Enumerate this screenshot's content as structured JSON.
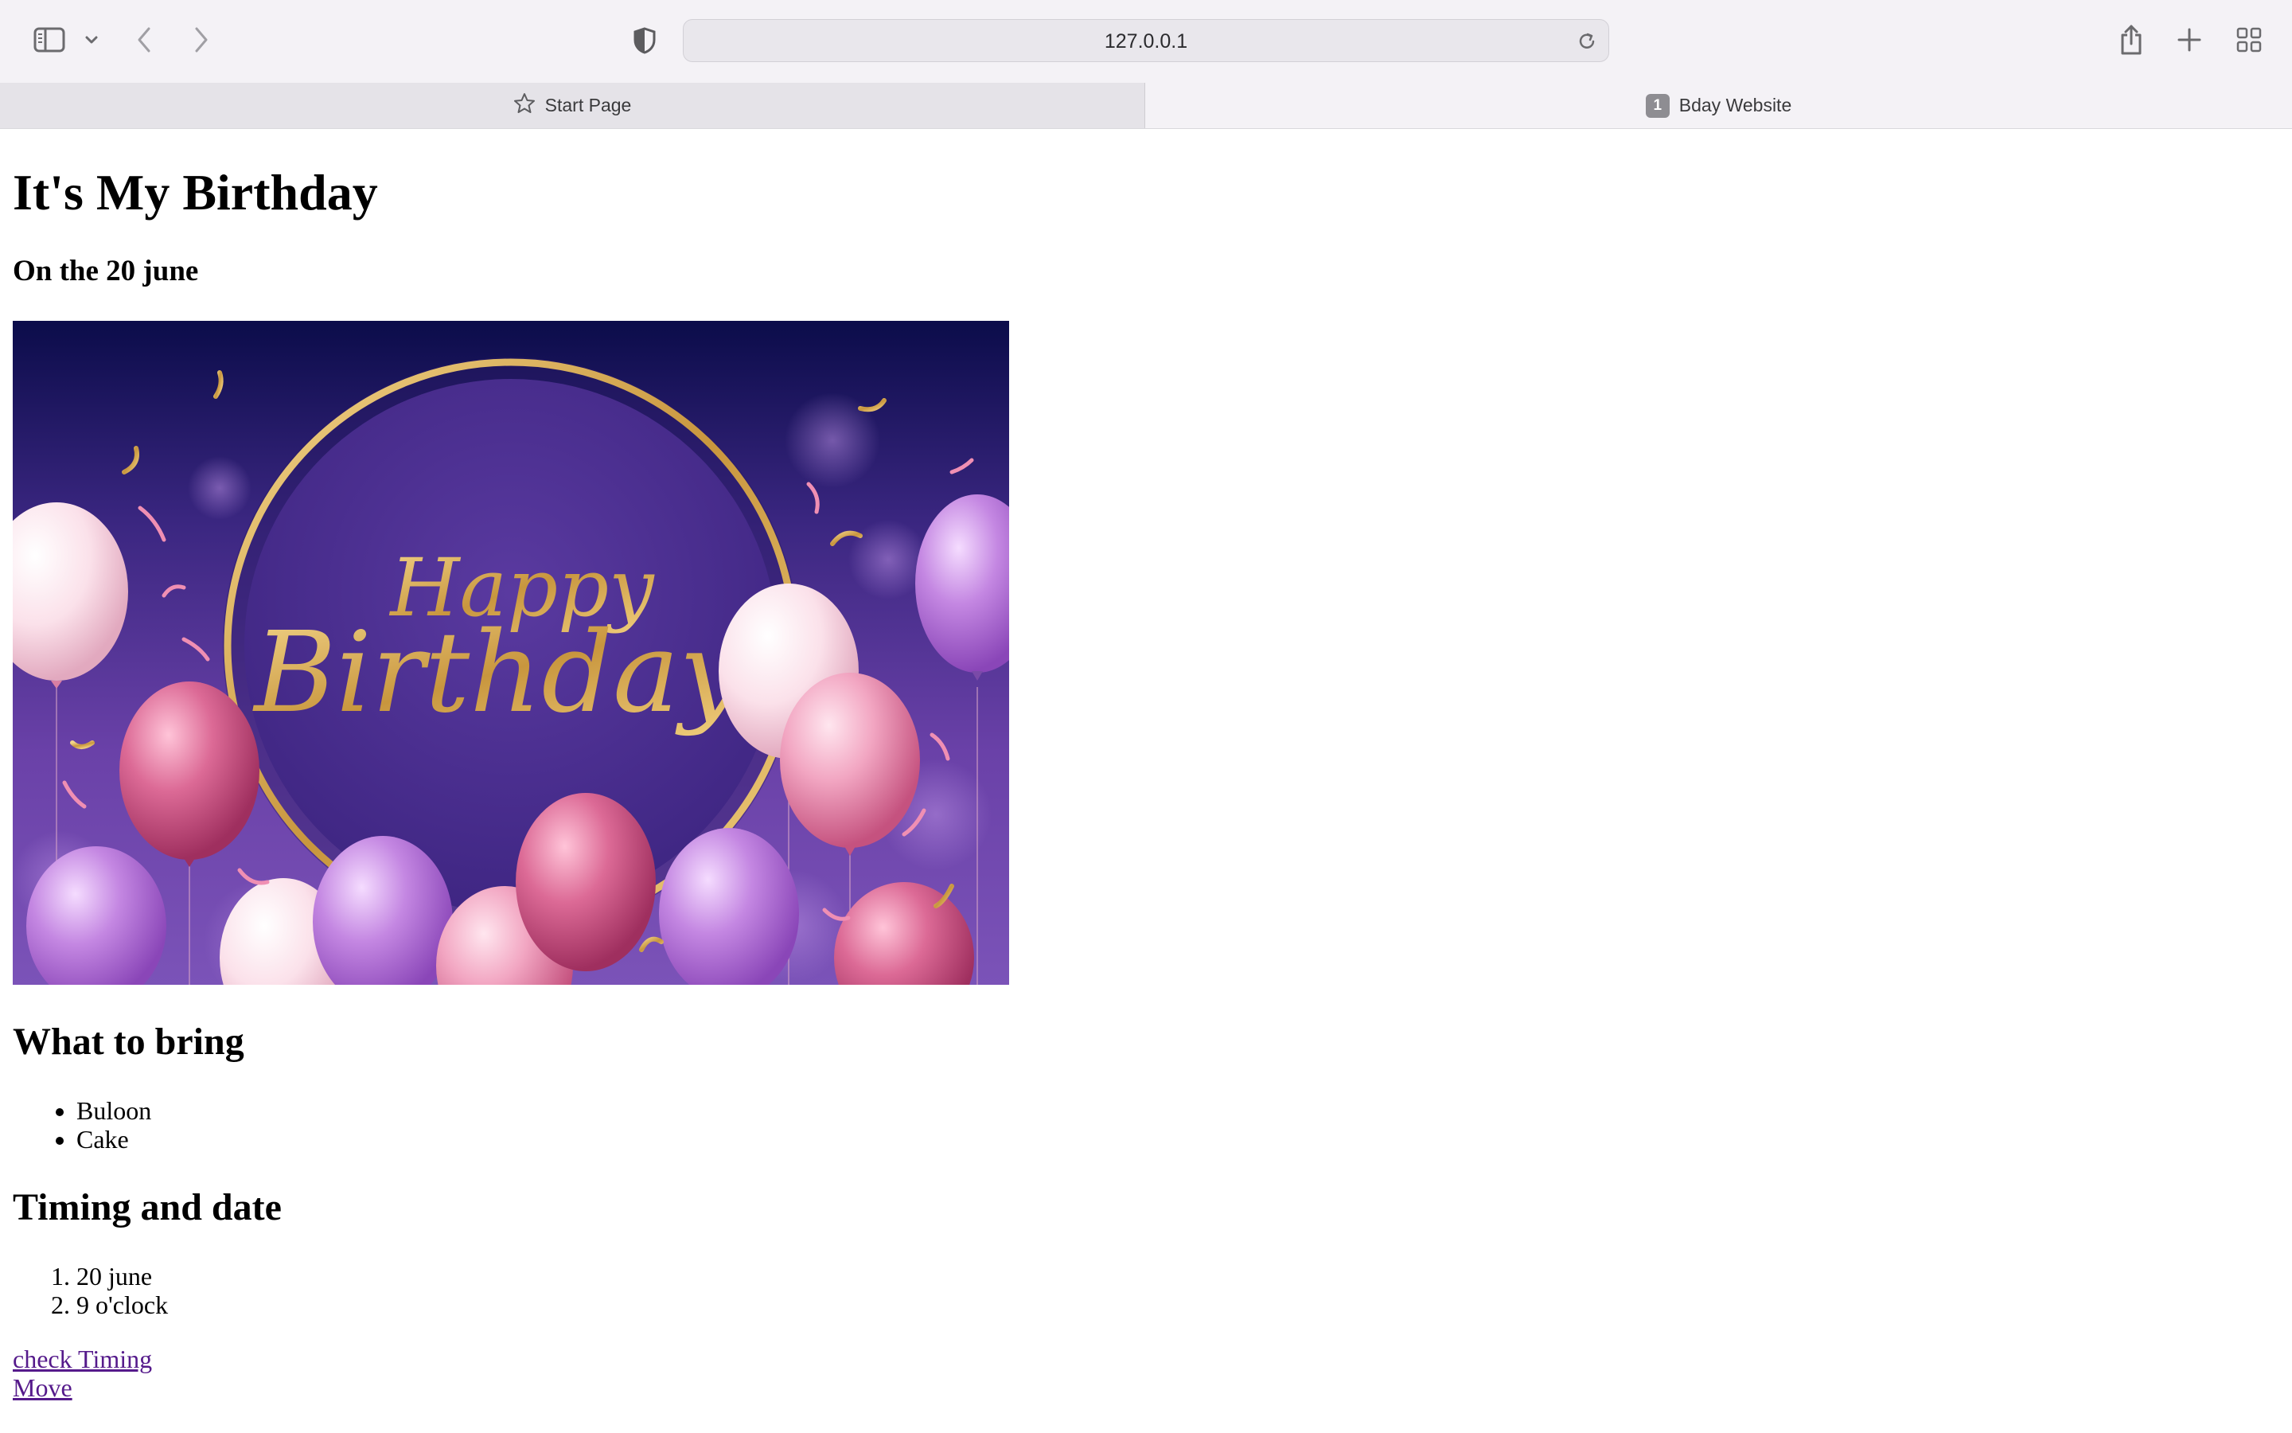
{
  "browser": {
    "url": "127.0.0.1",
    "tabs": [
      {
        "label": "Start Page",
        "active": false
      },
      {
        "label": "Bday Website",
        "active": true,
        "badge": "1"
      }
    ]
  },
  "page": {
    "title": "It's My Birthday",
    "subtitle": "On the 20 june",
    "banner_text_line1": "Happy",
    "banner_text_line2": "Birthday",
    "bring": {
      "heading": "What to bring",
      "items": [
        "Buloon",
        "Cake"
      ]
    },
    "timing": {
      "heading": "Timing and date",
      "items": [
        "20 june",
        "9 o'clock"
      ]
    },
    "links": [
      "check Timing ",
      "Move"
    ]
  },
  "colors": {
    "link": "#551a8b",
    "banner_gold": "#d9b15c",
    "banner_purple": "#5b3a9c"
  }
}
